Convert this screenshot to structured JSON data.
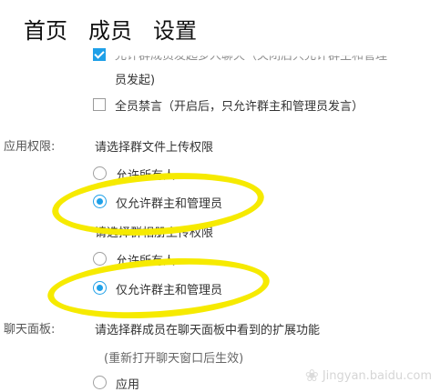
{
  "nav": {
    "home": "首页",
    "members": "成员",
    "settings": "设置"
  },
  "top_cut_text": "允许群成员发起多人聊天（关闭后只允许群主和管理",
  "top_cut_tail": "员发起)",
  "mute_all": {
    "label": "全员禁言（开启后，只允许群主和管理员发言）",
    "checked": false
  },
  "app_permissions": {
    "section_label": "应用权限:",
    "file_upload": {
      "prompt": "请选择群文件上传权限",
      "options": [
        "允许所有人",
        "仅允许群主和管理员"
      ],
      "selected_index": 1
    },
    "album_upload": {
      "prompt": "请选择群相册上传权限",
      "options": [
        "允许所有人",
        "仅允许群主和管理员"
      ],
      "selected_index": 1
    }
  },
  "chat_panel": {
    "section_label": "聊天面板:",
    "prompt": "请选择群成员在聊天面板中看到的扩展功能",
    "note": "(重新打开聊天窗口后生效)",
    "option_label": "应用"
  },
  "highlight_color": "#f6ea00",
  "accent_color": "#1fa0e8",
  "watermark": {
    "text": "Jingyan.baidu.com",
    "icon": "paw-icon"
  }
}
